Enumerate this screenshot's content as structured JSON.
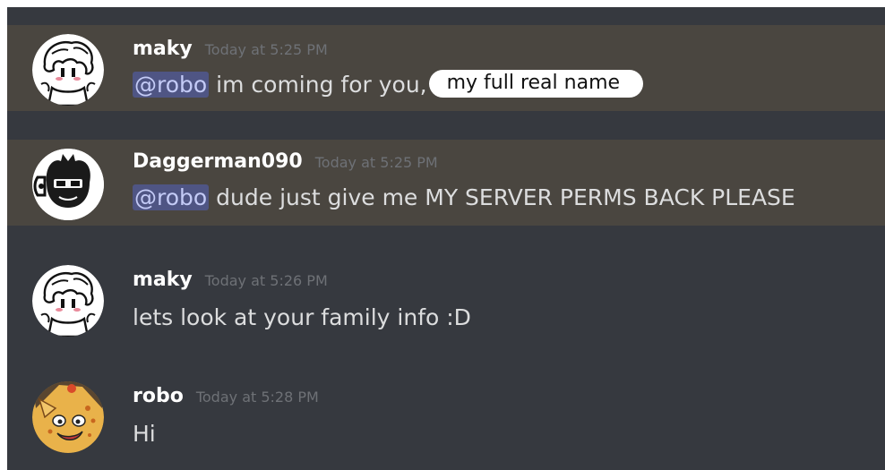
{
  "messages": [
    {
      "username": "maky",
      "timestamp": "Today at 5:25 PM",
      "mention": "@robo",
      "text": "im coming for you,",
      "redaction_label": "my full real name",
      "highlighted": true
    },
    {
      "username": "Daggerman090",
      "timestamp": "Today at 5:25 PM",
      "mention": "@robo",
      "text": "dude just give me MY SERVER PERMS BACK PLEASE",
      "highlighted": true
    },
    {
      "username": "maky",
      "timestamp": "Today at 5:26 PM",
      "text": "lets look at your family info :D",
      "highlighted": false
    },
    {
      "username": "robo",
      "timestamp": "Today at 5:28 PM",
      "text": "Hi",
      "highlighted": false
    }
  ],
  "colors": {
    "background": "#36393f",
    "highlight": "#4a4640",
    "mention_bg": "#4f5584",
    "mention_text": "#c4cbf6",
    "username": "#ffffff",
    "timestamp": "#6e7176",
    "message_text": "#dcddde"
  }
}
